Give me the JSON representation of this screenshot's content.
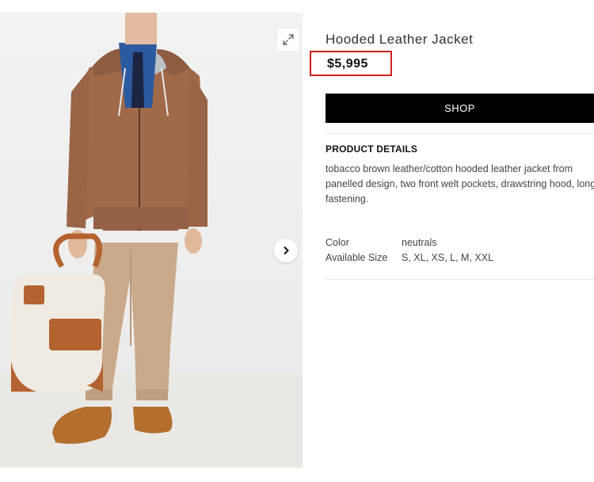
{
  "product": {
    "title": "Hooded Leather Jacket",
    "price": "$5,995",
    "shop_label": "SHOP",
    "details_heading": "PRODUCT DETAILS",
    "description_lines": [
      "tobacco brown leather/cotton hooded leather jacket from",
      "panelled design, two front welt pockets, drawstring hood, long s",
      "fastening."
    ],
    "attributes": [
      {
        "label": "Color",
        "value": "neutrals"
      },
      {
        "label": "Available Size",
        "value": "S, XL, XS, L, M, XXL"
      }
    ]
  },
  "gallery": {
    "expand_icon": "expand-icon",
    "next_icon": "chevron-right-icon"
  },
  "colors": {
    "highlight": "#d01f1f",
    "button_bg": "#000000",
    "jacket": "#a0694a",
    "pants": "#c9a98a",
    "bag": "#efebe3",
    "bag_trim": "#b4622f"
  }
}
